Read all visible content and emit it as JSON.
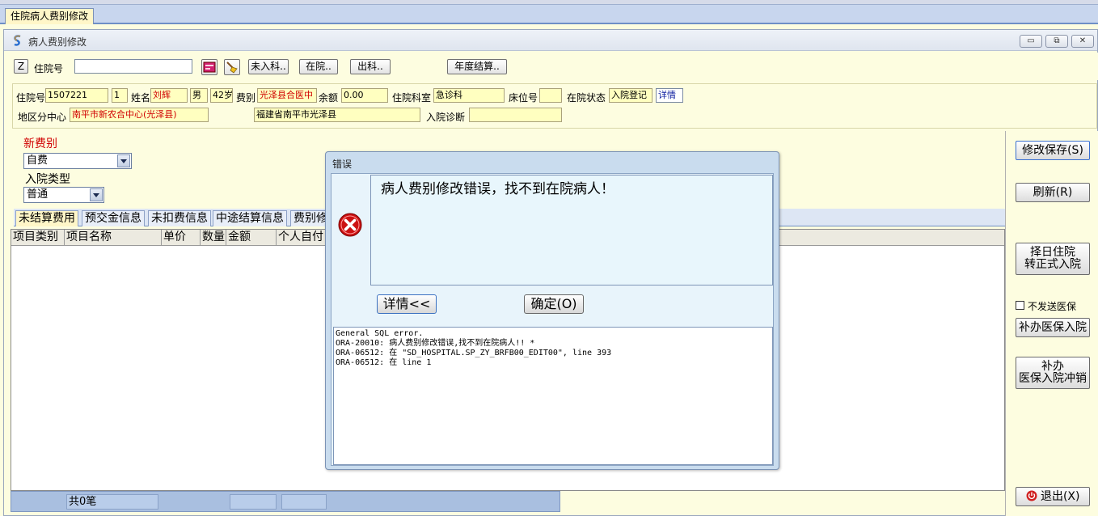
{
  "tabbar": {
    "doc_tab": "住院病人费别修改"
  },
  "window": {
    "title": "病人费别修改",
    "btn_min": "▭",
    "btn_restore": "⧉",
    "btn_close": "✕"
  },
  "toolbar": {
    "z_btn": "Z",
    "zyh_label": "住院号",
    "zyh_value": "",
    "btn_weiruke": "未入科..",
    "btn_zaiyuan": "在院..",
    "btn_chuke": "出科..",
    "btn_niandu": "年度结算.."
  },
  "patient": {
    "zyh_label": "住院号",
    "zyh_value": "1507221",
    "times_value": "1",
    "name_label": "姓名",
    "name_value": "刘辉",
    "sex_value": "男",
    "age_value": "42岁",
    "feibie_label": "费别",
    "feibie_value": "光泽县合医中",
    "balance_label": "余额",
    "balance_value": "0.00",
    "dept_label": "住院科室",
    "dept_value": "急诊科",
    "bed_label": "床位号",
    "bed_value": "",
    "status_label": "在院状态",
    "status_value": "入院登记",
    "detail_link": "详情",
    "region_label": "地区分中心",
    "region_value": "南平市新农合中心(光泽县)",
    "address_value": "福建省南平市光泽县",
    "diag_label": "入院诊断",
    "diag_value": ""
  },
  "form": {
    "new_feibie_label": "新费别",
    "new_feibie_value": "自费",
    "admit_type_label": "入院类型",
    "admit_type_value": "普通"
  },
  "tabs": [
    "未结算费用",
    "预交金信息",
    "未扣费信息",
    "中途结算信息",
    "费别修"
  ],
  "grid": {
    "columns": [
      "项目类别",
      "项目名称",
      "单价",
      "数量",
      "金额",
      "个人自付"
    ]
  },
  "footer": {
    "count": "共0笔",
    "cell2": "",
    "cell3": ""
  },
  "side": {
    "save": "修改保存(S)",
    "refresh": "刷新(R)",
    "convert_line1": "择日住院",
    "convert_line2": "转正式入院",
    "no_insurance_label": "不发送医保",
    "supp_admit": "补办医保入院",
    "supp_cancel_line1": "补办",
    "supp_cancel_line2": "医保入院冲销",
    "exit": "退出(X)"
  },
  "dialog": {
    "title": "错误",
    "message": "病人费别修改错误，找不到在院病人！",
    "btn_detail": "详情<<",
    "btn_ok": "确定(O)",
    "detail_text": "General SQL error.\nORA-20010: 病人费别修改错误,找不到在院病人!! *\nORA-06512: 在 \"SD_HOSPITAL.SP_ZY_BRFB00_EDIT00\", line 393\nORA-06512: 在 line 1"
  },
  "colors": {
    "accent_red": "#d00000",
    "panel": "#fdfde0",
    "dialog": "#c9dcee"
  }
}
